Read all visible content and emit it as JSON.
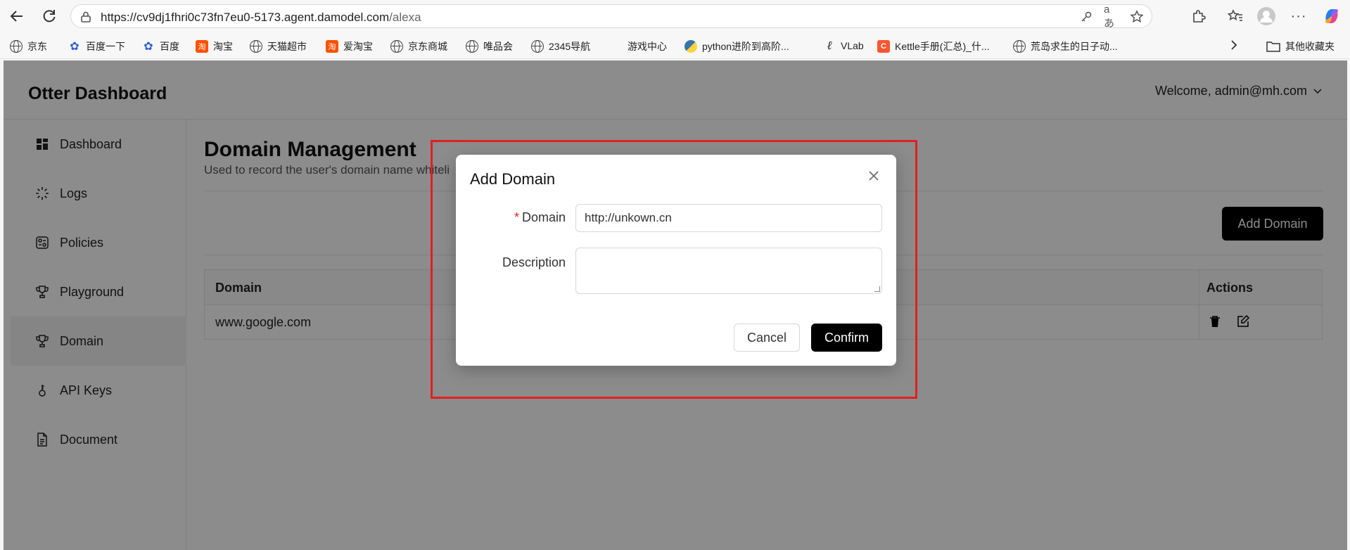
{
  "browser": {
    "url_main": "https://cv9dj1fhri0c73fn7eu0-5173.agent.damodel.com",
    "url_path": "/alexa",
    "bookmarks": [
      {
        "label": "京东",
        "icon": "globe-icon"
      },
      {
        "label": "百度一下",
        "icon": "baidu-paw-icon"
      },
      {
        "label": "百度",
        "icon": "baidu-paw-icon"
      },
      {
        "label": "淘宝",
        "icon": "taobao-icon"
      },
      {
        "label": "天猫超市",
        "icon": "globe-icon"
      },
      {
        "label": "爱淘宝",
        "icon": "taobao-icon"
      },
      {
        "label": "京东商城",
        "icon": "globe-icon"
      },
      {
        "label": "唯品会",
        "icon": "globe-icon"
      },
      {
        "label": "2345导航",
        "icon": "globe-icon"
      },
      {
        "label": "游戏中心",
        "icon": "none"
      },
      {
        "label": "python进阶到高阶...",
        "icon": "python-icon"
      },
      {
        "label": "VLab",
        "icon": "vlab-icon"
      },
      {
        "label": "Kettle手册(汇总)_什...",
        "icon": "csdn-icon"
      },
      {
        "label": "荒岛求生的日子动...",
        "icon": "globe-icon"
      }
    ],
    "other_bookmarks": "其他收藏夹"
  },
  "app": {
    "title": "Otter Dashboard",
    "welcome": "Welcome, admin@mh.com"
  },
  "sidebar": {
    "items": [
      {
        "label": "Dashboard",
        "icon": "grid-icon"
      },
      {
        "label": "Logs",
        "icon": "loader-icon"
      },
      {
        "label": "Policies",
        "icon": "policy-icon"
      },
      {
        "label": "Playground",
        "icon": "trophy-icon"
      },
      {
        "label": "Domain",
        "icon": "trophy-icon",
        "active": true
      },
      {
        "label": "API Keys",
        "icon": "key-icon"
      },
      {
        "label": "Document",
        "icon": "document-icon"
      }
    ]
  },
  "main": {
    "title": "Domain Management",
    "subtitle": "Used to record the user's domain name whiteli",
    "add_button": "Add Domain",
    "table": {
      "columns": [
        "Domain",
        "Actions"
      ],
      "rows": [
        {
          "domain": "www.google.com"
        }
      ]
    }
  },
  "modal": {
    "title": "Add Domain",
    "domain_label": "Domain",
    "domain_required": "*",
    "domain_value": "http://unkown.cn",
    "description_label": "Description",
    "description_value": "",
    "cancel": "Cancel",
    "confirm": "Confirm"
  },
  "colors": {
    "highlight_border": "#e02020",
    "primary_button": "#000000",
    "overlay": "rgba(0,0,0,0.45)"
  }
}
